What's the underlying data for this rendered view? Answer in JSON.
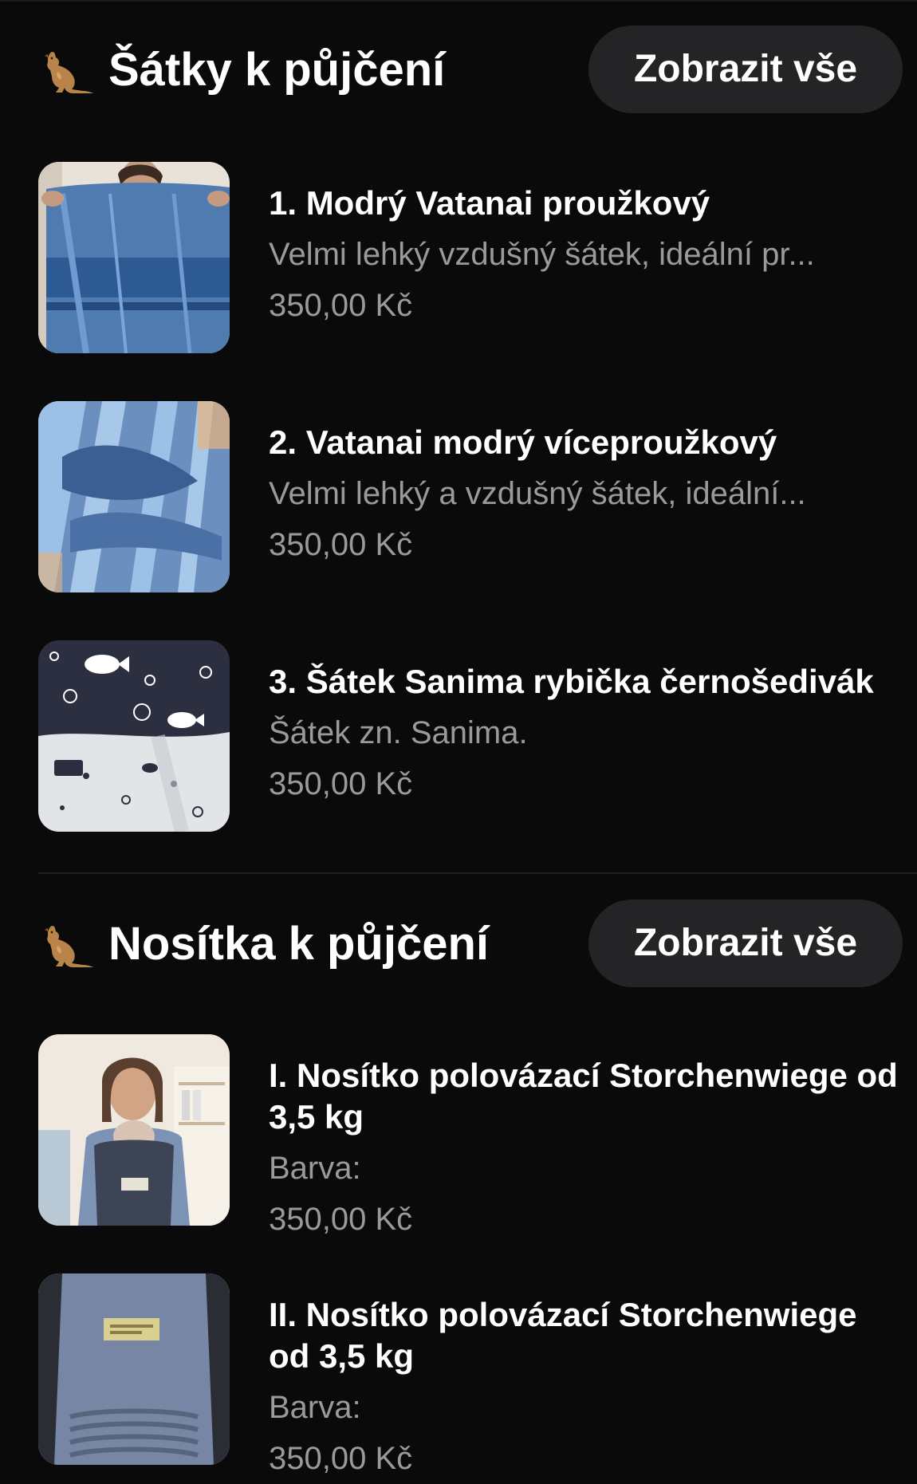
{
  "sections": [
    {
      "icon": "kangaroo-icon",
      "title": "Šátky k půjčení",
      "see_all_label": "Zobrazit vše",
      "items": [
        {
          "title": "1. Modrý Vatanai proužkový",
          "description": "Velmi lehký vzdušný šátek, ideální pr...",
          "price": "350,00 Kč"
        },
        {
          "title": "2. Vatanai modrý víceproužkový",
          "description": "Velmi lehký a vzdušný šátek, ideální...",
          "price": "350,00 Kč"
        },
        {
          "title": "3. Šátek Sanima rybička černošedivák",
          "description": "Šátek zn. Sanima.",
          "price": "350,00 Kč"
        }
      ]
    },
    {
      "icon": "kangaroo-icon",
      "title": "Nosítka k půjčení",
      "see_all_label": "Zobrazit vše",
      "items": [
        {
          "title": "I. Nosítko polovázací Storchenwiege od 3,5 kg",
          "description": "Barva:",
          "price": "350,00 Kč"
        },
        {
          "title": "II. Nosítko polovázací Storchenwiege od 3,5 kg",
          "description": "Barva:",
          "price": "350,00 Kč"
        }
      ]
    }
  ],
  "colors": {
    "background": "#0a0a0a",
    "button_background": "#242426",
    "primary_text": "#ffffff",
    "secondary_text": "#9a9a9e"
  }
}
